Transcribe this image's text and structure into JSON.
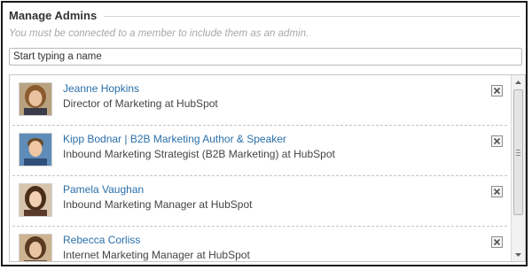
{
  "section": {
    "title": "Manage Admins",
    "hint": "You must be connected to a member to include them as an admin."
  },
  "search": {
    "placeholder": "Start typing a name"
  },
  "admins": [
    {
      "name": "Jeanne Hopkins",
      "title": "Director of Marketing at HubSpot",
      "remove_icon": "close-x-icon"
    },
    {
      "name": "Kipp Bodnar | B2B Marketing Author & Speaker",
      "title": "Inbound Marketing Strategist (B2B Marketing) at HubSpot",
      "remove_icon": "close-x-icon"
    },
    {
      "name": "Pamela Vaughan",
      "title": "Inbound Marketing Manager at HubSpot",
      "remove_icon": "close-x-icon"
    },
    {
      "name": "Rebecca Corliss",
      "title": "Internet Marketing Manager at HubSpot",
      "remove_icon": "close-x-icon"
    }
  ],
  "colors": {
    "link": "#2a6fa9",
    "text": "#444444",
    "hint": "#a8a8a8"
  }
}
